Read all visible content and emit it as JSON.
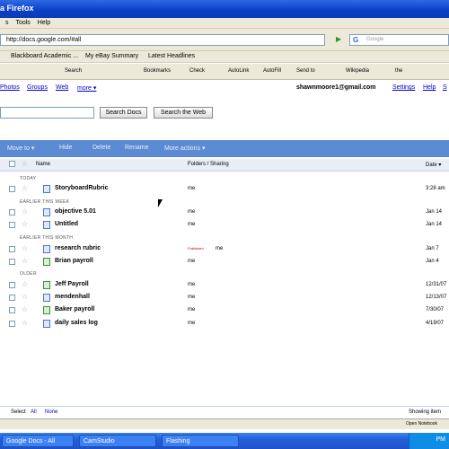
{
  "window": {
    "title": "a Firefox"
  },
  "menu": [
    "s",
    "Tools",
    "Help"
  ],
  "urlbar": {
    "value": "http://docs.google.com/#all"
  },
  "searchbar": {
    "placeholder": "Google"
  },
  "bookmarks": [
    "Blackboard Academic ...",
    "My eBay Summary",
    "Latest Headlines"
  ],
  "toolbar2": [
    "Search",
    "Bookmarks",
    "Check",
    "AutoLink",
    "AutoFill",
    "Send to",
    "Wikipedia",
    "the"
  ],
  "gnav": {
    "links": [
      "Photos",
      "Groups",
      "Web",
      "more ▾"
    ],
    "email": "shawnmoore1@gmail.com",
    "settings": "Settings",
    "help": "Help",
    "signout": "S"
  },
  "docsearch": {
    "search_docs": "Search Docs",
    "search_web": "Search the Web"
  },
  "actions": [
    "Move to ▾",
    "Hide",
    "Delete",
    "Rename",
    "More actions ▾"
  ],
  "columns": {
    "name": "Name",
    "folders": "Folders / Sharing",
    "date": "Date ▾"
  },
  "groups": {
    "today": "TODAY",
    "earlier_week": "EARLIER THIS WEEK",
    "earlier_month": "EARLIER THIS MONTH",
    "older": "OLDER"
  },
  "rows": [
    {
      "name": "StoryboardRubric",
      "owner": "me",
      "date": "3:28 am"
    },
    {
      "name": "objective 5.01",
      "owner": "me",
      "date": "Jan 14"
    },
    {
      "name": "Untitled",
      "owner": "me",
      "date": "Jan 14"
    },
    {
      "name": "research rubric",
      "published": "Published",
      "owner": "me",
      "date": "Jan 7"
    },
    {
      "name": "Brian payroll",
      "owner": "me",
      "date": "Jan 4"
    },
    {
      "name": "Jeff Payroll",
      "owner": "me",
      "date": "12/31/07"
    },
    {
      "name": "mendenhall",
      "owner": "me",
      "date": "12/13/07"
    },
    {
      "name": "Baker payroll",
      "owner": "me",
      "date": "7/30/07"
    },
    {
      "name": "daily sales log",
      "owner": "me",
      "date": "4/19/07"
    }
  ],
  "footer": {
    "select": "Select",
    "all": "All",
    "none": "None",
    "showing": "Showing item"
  },
  "status": {
    "text": "Open Notebook"
  },
  "taskbar": [
    "Google Docs - All item...",
    "CamStudio",
    "Flashing"
  ],
  "clock": "PM"
}
